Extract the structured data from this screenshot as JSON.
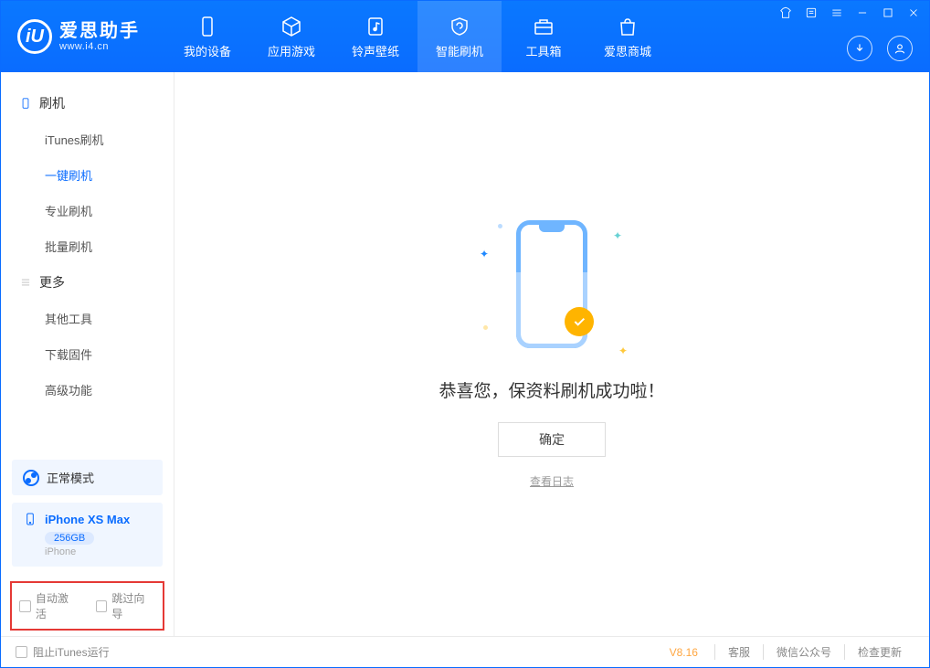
{
  "app": {
    "name": "爱思助手",
    "domain": "www.i4.cn"
  },
  "tabs": [
    {
      "label": "我的设备"
    },
    {
      "label": "应用游戏"
    },
    {
      "label": "铃声壁纸"
    },
    {
      "label": "智能刷机",
      "active": true
    },
    {
      "label": "工具箱"
    },
    {
      "label": "爱思商城"
    }
  ],
  "sidebar": {
    "groups": [
      {
        "title": "刷机",
        "items": [
          {
            "label": "iTunes刷机"
          },
          {
            "label": "一键刷机",
            "active": true
          },
          {
            "label": "专业刷机"
          },
          {
            "label": "批量刷机"
          }
        ]
      },
      {
        "title": "更多",
        "items": [
          {
            "label": "其他工具"
          },
          {
            "label": "下载固件"
          },
          {
            "label": "高级功能"
          }
        ]
      }
    ],
    "mode": "正常模式",
    "device": {
      "name": "iPhone XS Max",
      "capacity": "256GB",
      "type": "iPhone"
    },
    "checks": {
      "auto_activate": "自动激活",
      "skip_guide": "跳过向导"
    }
  },
  "main": {
    "success": "恭喜您，保资料刷机成功啦！",
    "ok": "确定",
    "view_log": "查看日志"
  },
  "footer": {
    "block_itunes": "阻止iTunes运行",
    "version": "V8.16",
    "links": [
      "客服",
      "微信公众号",
      "检查更新"
    ]
  }
}
